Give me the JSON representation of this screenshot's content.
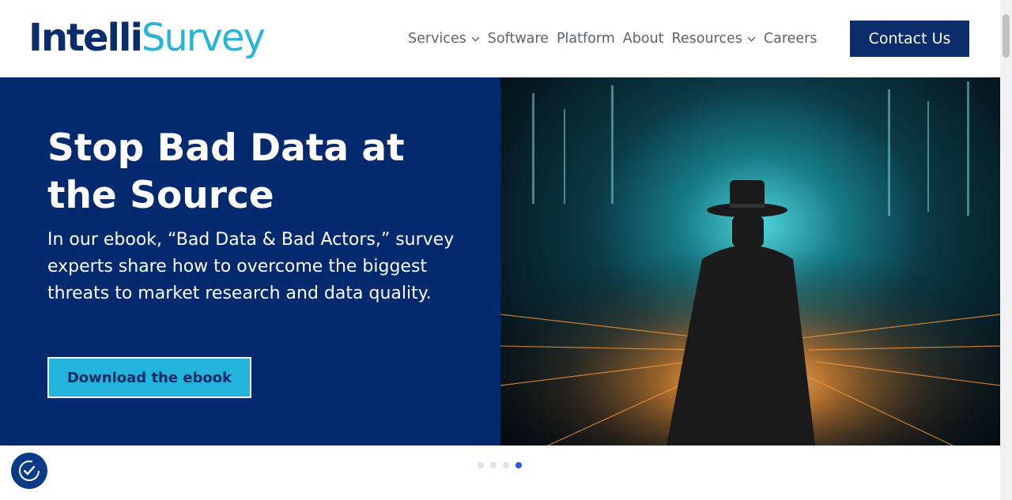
{
  "header": {
    "logo_part1": "Intelli",
    "logo_part2": "Survey",
    "nav": [
      {
        "label": "Services",
        "has_dropdown": true
      },
      {
        "label": "Software",
        "has_dropdown": false
      },
      {
        "label": "Platform",
        "has_dropdown": false
      },
      {
        "label": "About",
        "has_dropdown": false
      },
      {
        "label": "Resources",
        "has_dropdown": true
      },
      {
        "label": "Careers",
        "has_dropdown": false
      }
    ],
    "contact_label": "Contact Us"
  },
  "hero": {
    "title": "Stop Bad Data at the Source",
    "body": "In our ebook, “Bad Data & Bad Actors,” survey experts share how to overcome the biggest threats to market research and data quality.",
    "cta_label": "Download the ebook"
  },
  "carousel": {
    "slide_count": 4,
    "active_index": 3
  },
  "icons": {
    "chevron": "chevron-down-icon",
    "accessibility": "accessibility-check-icon"
  },
  "colors": {
    "brand_navy": "#0b2d6b",
    "hero_bg": "#03296e",
    "accent_cyan": "#23b4dd"
  }
}
